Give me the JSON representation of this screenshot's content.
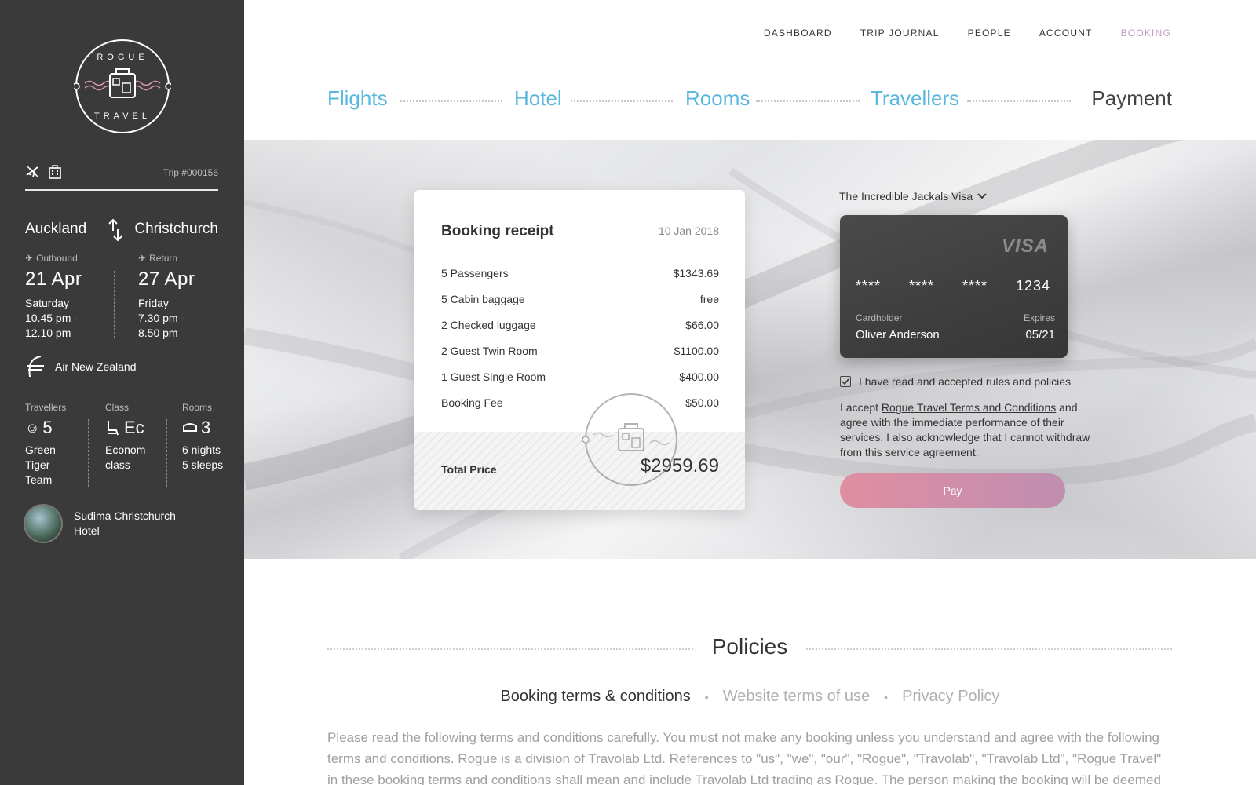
{
  "brand": {
    "logo_top": "ROGUE",
    "logo_bottom": "TRAVEL",
    "icon": "suitcase-icon"
  },
  "trip": {
    "number": "Trip #000156",
    "icons": [
      "plane-icon",
      "hotel-icon"
    ]
  },
  "route": {
    "from": "Auckland",
    "to": "Christchurch",
    "icon": "swap-icon"
  },
  "outbound": {
    "label": "Outbound",
    "date": "21 Apr",
    "day": "Saturday",
    "time": "10.45 pm -\n12.10 pm"
  },
  "return_leg": {
    "label": "Return",
    "date": "27 Apr",
    "day": "Friday",
    "time": "7.30 pm -\n8.50 pm"
  },
  "airline": {
    "name": "Air New Zealand",
    "icon": "airline-icon"
  },
  "stats": {
    "travellers": {
      "label": "Travellers",
      "value": "5",
      "sub": "Green\nTiger\nTeam"
    },
    "class": {
      "label": "Class",
      "value": "Ec",
      "sub": "Econom\nclass"
    },
    "rooms": {
      "label": "Rooms",
      "value": "3",
      "sub": "6 nights\n5 sleeps"
    }
  },
  "hotel": {
    "name": "Sudima Christchurch\nHotel"
  },
  "nav": {
    "items": [
      "DASHBOARD",
      "TRIP JOURNAL",
      "PEOPLE",
      "ACCOUNT",
      "BOOKING"
    ],
    "active": "BOOKING"
  },
  "steps": [
    "Flights",
    "Hotel",
    "Rooms",
    "Travellers",
    "Payment"
  ],
  "receipt": {
    "title": "Booking receipt",
    "date": "10 Jan 2018",
    "rows": [
      {
        "label": "5 Passengers",
        "value": "$1343.69"
      },
      {
        "label": "5 Cabin baggage",
        "value": "free"
      },
      {
        "label": "2 Checked luggage",
        "value": "$66.00"
      },
      {
        "label": "2 Guest Twin Room",
        "value": "$1100.00"
      },
      {
        "label": "1 Guest Single Room",
        "value": "$400.00"
      },
      {
        "label": "Booking Fee",
        "value": "$50.00"
      }
    ],
    "total_label": "Total Price",
    "total_value": "$2959.69"
  },
  "card": {
    "select_label": "The Incredible Jackals Visa",
    "brand": "VISA",
    "groups": [
      "****",
      "****",
      "****",
      "1234"
    ],
    "holder_label": "Cardholder",
    "holder": "Oliver Anderson",
    "expires_label": "Expires",
    "expires": "05/21"
  },
  "agreement": {
    "checkbox_label": "I have read and accepted rules and policies",
    "checked": true,
    "text_before": "I accept ",
    "link": "Rogue Travel Terms and Conditions",
    "text_after": " and agree with the immediate performance of their services. I also acknowledge that I cannot withdraw from this service agreement."
  },
  "pay_label": "Pay",
  "colors": {
    "accent_blue": "#5ab8de",
    "accent_purple": "#c497c8",
    "pay_from": "#e08ea1",
    "pay_to": "#c08eb0",
    "sidebar": "#3a3a3b"
  },
  "policies": {
    "title": "Policies",
    "tabs": [
      "Booking terms & conditions",
      "Website terms of use",
      "Privacy Policy"
    ],
    "active_tab": "Booking terms & conditions",
    "text": "Please read the following terms and conditions carefully. You must not make any booking unless you understand and agree with the following terms and conditions. Rogue is a division of Travolab Ltd. References to \"us\", \"we\", \"our\", \"Rogue\", \"Travolab\", \"Travolab Ltd\", \"Rogue Travel\" in these booking terms and conditions shall mean and include Travolab Ltd trading as Rogue. The person making the booking will be deemed to"
  }
}
